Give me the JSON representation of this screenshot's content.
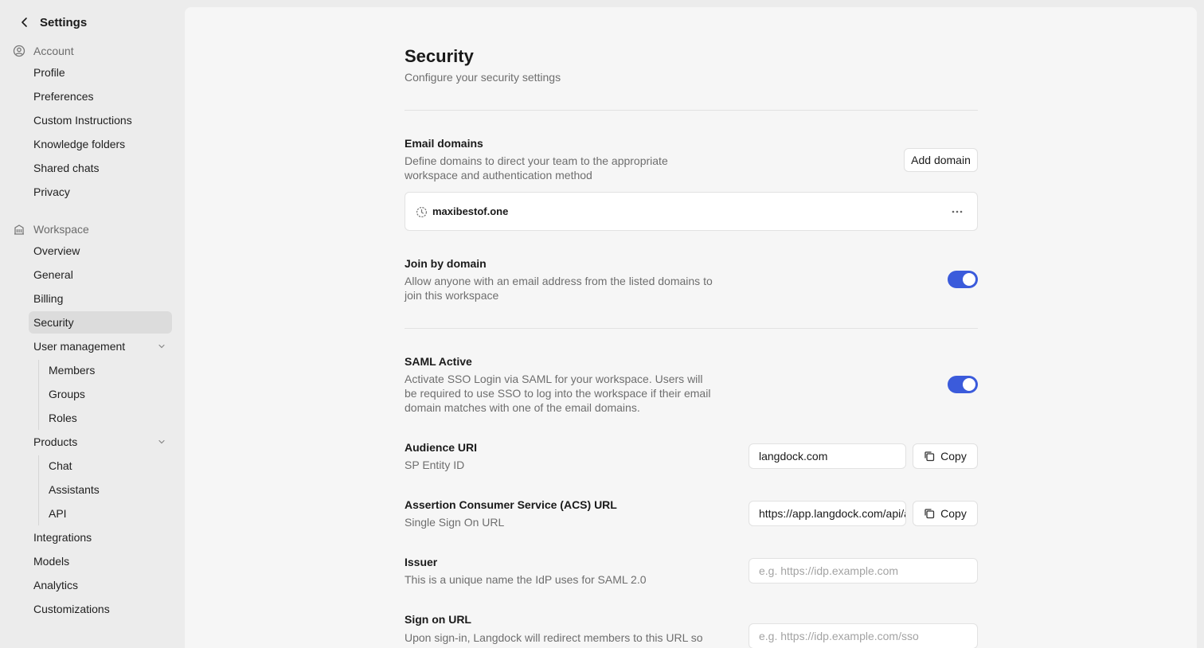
{
  "sidebar": {
    "back_label": "Settings",
    "account_label": "Account",
    "account_items": [
      "Profile",
      "Preferences",
      "Custom Instructions",
      "Knowledge folders",
      "Shared chats",
      "Privacy"
    ],
    "workspace_label": "Workspace",
    "workspace_items": [
      "Overview",
      "General",
      "Billing",
      "Security"
    ],
    "user_management": {
      "label": "User management",
      "items": [
        "Members",
        "Groups",
        "Roles"
      ]
    },
    "products": {
      "label": "Products",
      "items": [
        "Chat",
        "Assistants",
        "API"
      ]
    },
    "bottom_items": [
      "Integrations",
      "Models",
      "Analytics",
      "Customizations"
    ],
    "active": "Security"
  },
  "main": {
    "title": "Security",
    "subtitle": "Configure your security settings",
    "email_domains": {
      "title": "Email domains",
      "desc": "Define domains to direct your team to the appropriate workspace and authentication method",
      "add_label": "Add domain",
      "domains": [
        "maxibestof.one"
      ]
    },
    "join_by_domain": {
      "title": "Join by domain",
      "desc": "Allow anyone with an email address from the listed domains to join this workspace",
      "enabled": true
    },
    "saml_active": {
      "title": "SAML Active",
      "desc": "Activate SSO Login via SAML for your workspace. Users will be required to use SSO to log into the workspace if their email domain matches with one of the email domains.",
      "enabled": true
    },
    "audience_uri": {
      "title": "Audience URI",
      "desc": "SP Entity ID",
      "value": "langdock.com",
      "copy_label": "Copy"
    },
    "acs_url": {
      "title": "Assertion Consumer Service (ACS) URL",
      "desc": "Single Sign On URL",
      "value": "https://app.langdock.com/api/auth/saml/callback",
      "copy_label": "Copy"
    },
    "issuer": {
      "title": "Issuer",
      "desc": "This is a unique name the IdP uses for SAML 2.0",
      "placeholder": "e.g. https://idp.example.com"
    },
    "sign_on_url": {
      "title": "Sign on URL",
      "desc": "Upon sign-in, Langdock will redirect members to this URL so your IdP can authenticate them.",
      "placeholder": "e.g. https://idp.example.com/sso"
    }
  },
  "colors": {
    "accent": "#3b5bdb",
    "sidebar_bg": "#ececec",
    "panel_bg": "#f6f6f6",
    "active_item_bg": "#dcdcdc"
  }
}
